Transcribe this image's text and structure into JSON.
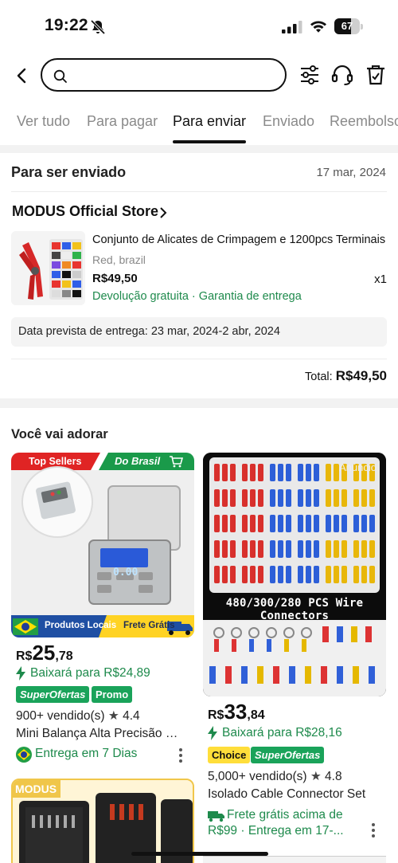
{
  "status_bar": {
    "time": "19:22",
    "battery": "67",
    "battery_level": 0.67
  },
  "search": {
    "placeholder": ""
  },
  "tabs": [
    "Ver tudo",
    "Para pagar",
    "Para enviar",
    "Enviado",
    "Reembolso"
  ],
  "active_tab": "Para enviar",
  "order": {
    "heading": "Para ser enviado",
    "date": "17 mar, 2024",
    "store": "MODUS Official Store",
    "product": {
      "title": "Conjunto de Alicates de Crimpagem e 1200pcs Terminais",
      "variant": "Red, brazil",
      "price": "R$49,50",
      "qty": "x1",
      "service": "Devolução gratuita · Garantia de entrega"
    },
    "delivery_estimate": "Data prevista de entrega: 23 mar, 2024-2 abr, 2024",
    "total_label": "Total:",
    "total_value": "R$49,50"
  },
  "recommendations": {
    "heading": "Você vai adorar",
    "items": [
      {
        "banner_left": "Top Sellers",
        "banner_right": "Do Brasil",
        "footer_left": "Produtos Locais",
        "footer_right": "Frete Grátis",
        "scale_display": "0.00",
        "price_currency": "R$",
        "price_int": "25",
        "price_dec": ",78",
        "drop": "Baixará para R$24,89",
        "badges": [
          "SuperOfertas",
          "Promo"
        ],
        "sold": "900+  vendido(s)",
        "rating": "4.4",
        "name": "Mini Balança Alta Precisão Digital",
        "shipping": "Entrega em 7 Dias"
      },
      {
        "ad_label": "Anúncio",
        "image_caption": "480/300/280 PCS Wire Connectors",
        "price_currency": "R$",
        "price_int": "33",
        "price_dec": ",84",
        "drop": "Baixará para R$28,16",
        "badges": [
          "Choice",
          "SuperOfertas"
        ],
        "sold": "5,000+  vendido(s)",
        "rating": "4.8",
        "name": "Isolado Cable Connector Set",
        "shipping_1": "Frete grátis acima de",
        "shipping_2": "R$99 · Entrega em 17-..."
      },
      {
        "brand_tag": "MODUS"
      }
    ]
  },
  "colors": {
    "accent_green": "#1e8a4c",
    "badge_green": "#1aa35a",
    "choice_yellow": "#ffde3a",
    "banner_red": "#e02424"
  },
  "icons": [
    "bell-slash-icon",
    "signal-icon",
    "wifi-icon",
    "battery-icon",
    "back-icon",
    "search-icon",
    "filter-icon",
    "support-icon",
    "trash-icon",
    "chevron-right-icon",
    "lightning-icon",
    "star-icon",
    "brazil-flag-icon",
    "truck-icon",
    "cart-icon",
    "kebab-icon"
  ]
}
